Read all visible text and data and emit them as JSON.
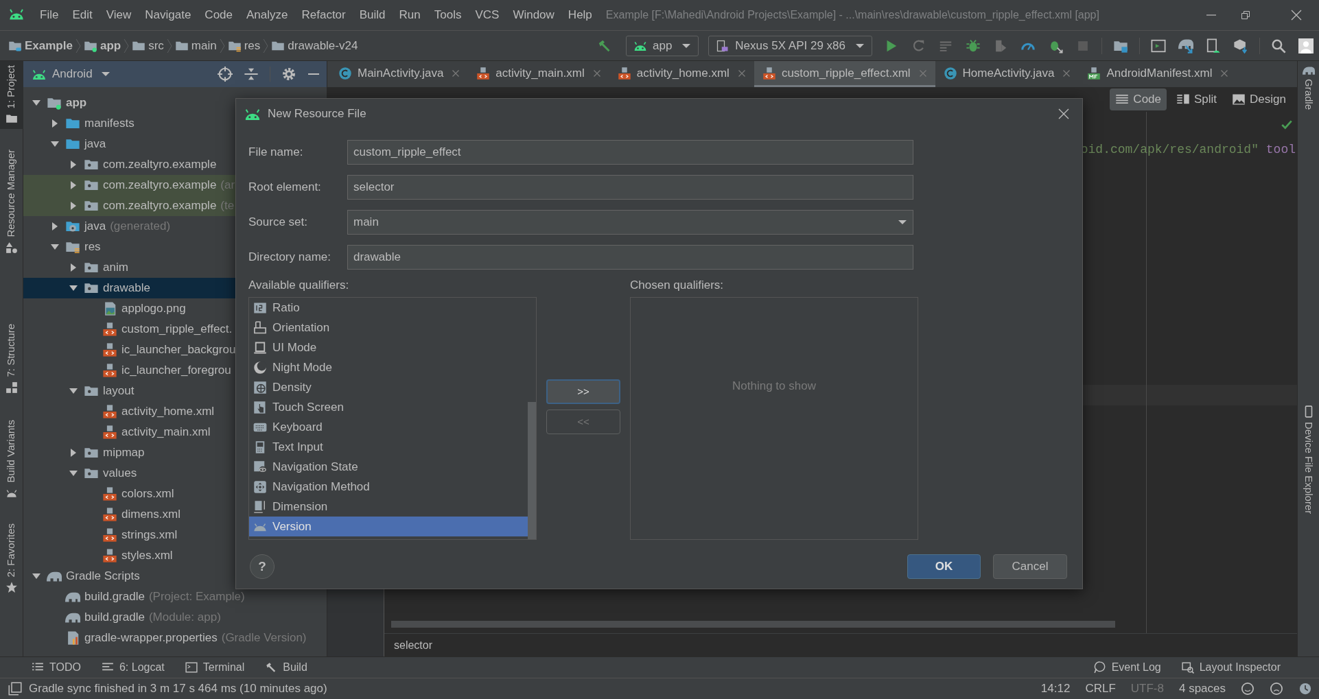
{
  "menu_bar": {
    "menus": [
      "File",
      "Edit",
      "View",
      "Navigate",
      "Code",
      "Analyze",
      "Refactor",
      "Build",
      "Run",
      "Tools",
      "VCS",
      "Window",
      "Help"
    ],
    "title": "Example [F:\\Mahedi\\Android Projects\\Example] - ...\\main\\res\\drawable\\custom_ripple_effect.xml [app]"
  },
  "breadcrumbs": [
    {
      "label": "Example",
      "kind": "project"
    },
    {
      "label": "app",
      "kind": "module"
    },
    {
      "label": "src",
      "kind": "folder"
    },
    {
      "label": "main",
      "kind": "folder"
    },
    {
      "label": "res",
      "kind": "res"
    },
    {
      "label": "drawable-v24",
      "kind": "folder"
    }
  ],
  "run_toolbar": {
    "configuration": "app",
    "device": "Nexus 5X API 29 x86"
  },
  "left_strip": [
    {
      "label": "1: Project",
      "kind": "project",
      "selected": true
    },
    {
      "label": "Resource Manager",
      "kind": "resources",
      "selected": false
    },
    {
      "label": "7: Structure",
      "kind": "structure",
      "selected": false
    },
    {
      "label": "Build Variants",
      "kind": "variants",
      "selected": false
    },
    {
      "label": "2: Favorites",
      "kind": "favorites",
      "selected": false
    }
  ],
  "project_panel": {
    "view": "Android",
    "tree": [
      {
        "label": "app",
        "kind": "module",
        "expanded": true,
        "selected": false,
        "children": [
          {
            "label": "manifests",
            "kind": "folder_blue",
            "expanded": false,
            "selected": false
          },
          {
            "label": "java",
            "kind": "folder_blue",
            "expanded": true,
            "selected": false,
            "children": [
              {
                "label": "com.zealtyro.example",
                "kind": "package",
                "expanded": false,
                "selected": false
              },
              {
                "label": "com.zealtyro.example",
                "note": "(ar",
                "kind": "package_test",
                "expanded": false,
                "selected": false
              },
              {
                "label": "com.zealtyro.example",
                "note": "(te",
                "kind": "package_test",
                "expanded": false,
                "selected": false
              }
            ]
          },
          {
            "label": "java",
            "note": "(generated)",
            "kind": "generated",
            "expanded": false,
            "selected": false
          },
          {
            "label": "res",
            "kind": "res",
            "expanded": true,
            "selected": false,
            "children": [
              {
                "label": "anim",
                "kind": "package",
                "expanded": false,
                "selected": false
              },
              {
                "label": "drawable",
                "kind": "package",
                "expanded": true,
                "selected": true,
                "children": [
                  {
                    "label": "applogo.png",
                    "kind": "image",
                    "selected": false
                  },
                  {
                    "label": "custom_ripple_effect.",
                    "kind": "xml",
                    "selected": false
                  },
                  {
                    "label": "ic_launcher_backgrou",
                    "kind": "xml",
                    "selected": false
                  },
                  {
                    "label": "ic_launcher_foregrou",
                    "kind": "xml",
                    "selected": false
                  }
                ]
              },
              {
                "label": "layout",
                "kind": "package",
                "expanded": true,
                "selected": false,
                "children": [
                  {
                    "label": "activity_home.xml",
                    "kind": "xml",
                    "selected": false
                  },
                  {
                    "label": "activity_main.xml",
                    "kind": "xml",
                    "selected": false
                  }
                ]
              },
              {
                "label": "mipmap",
                "kind": "package",
                "expanded": false,
                "selected": false
              },
              {
                "label": "values",
                "kind": "package",
                "expanded": true,
                "selected": false,
                "children": [
                  {
                    "label": "colors.xml",
                    "kind": "xml",
                    "selected": false
                  },
                  {
                    "label": "dimens.xml",
                    "kind": "xml",
                    "selected": false
                  },
                  {
                    "label": "strings.xml",
                    "kind": "xml",
                    "selected": false
                  },
                  {
                    "label": "styles.xml",
                    "kind": "xml",
                    "selected": false
                  }
                ]
              }
            ]
          }
        ]
      },
      {
        "label": "Gradle Scripts",
        "kind": "gradle_group",
        "expanded": true,
        "selected": false,
        "children": [
          {
            "label": "build.gradle",
            "note": "(Project: Example)",
            "kind": "gradle",
            "selected": false
          },
          {
            "label": "build.gradle",
            "note": "(Module: app)",
            "kind": "gradle",
            "selected": false
          },
          {
            "label": "gradle-wrapper.properties",
            "note": "(Gradle Version)",
            "kind": "properties",
            "selected": false
          }
        ]
      }
    ]
  },
  "editor_tabs": [
    {
      "label": "MainActivity.java",
      "kind": "java",
      "selected": false
    },
    {
      "label": "activity_main.xml",
      "kind": "xml",
      "selected": false
    },
    {
      "label": "activity_home.xml",
      "kind": "xml",
      "selected": false
    },
    {
      "label": "custom_ripple_effect.xml",
      "kind": "xml",
      "selected": true
    },
    {
      "label": "HomeActivity.java",
      "kind": "java",
      "selected": false
    },
    {
      "label": "AndroidManifest.xml",
      "kind": "manifest",
      "selected": false
    }
  ],
  "view_modes": [
    {
      "label": "Code",
      "kind": "code",
      "selected": true
    },
    {
      "label": "Split",
      "kind": "split",
      "selected": false
    },
    {
      "label": "Design",
      "kind": "design",
      "selected": false
    }
  ],
  "editor": {
    "code_line": [
      {
        "text": "oid.com/apk/res/android\"",
        "kind": "string"
      },
      {
        "text": " tool",
        "kind": "attribute"
      }
    ],
    "breadcrumb": "selector"
  },
  "right_strip": [
    {
      "label": "Gradle",
      "kind": "gradle"
    },
    {
      "label": "Device File Explorer",
      "kind": "device"
    }
  ],
  "dialog": {
    "title": "New Resource File",
    "fields": [
      {
        "label": "File name:",
        "value": "custom_ripple_effect",
        "kind": "text"
      },
      {
        "label": "Root element:",
        "value": "selector",
        "kind": "text"
      },
      {
        "label": "Source set:",
        "value": "main",
        "kind": "dropdown"
      },
      {
        "label": "Directory name:",
        "value": "drawable",
        "kind": "text"
      }
    ],
    "available_label": "Available qualifiers:",
    "chosen_label": "Chosen qualifiers:",
    "qualifiers": [
      {
        "label": "Ratio",
        "kind": "ratio",
        "selected": false
      },
      {
        "label": "Orientation",
        "kind": "orientation",
        "selected": false
      },
      {
        "label": "UI Mode",
        "kind": "uimode",
        "selected": false
      },
      {
        "label": "Night Mode",
        "kind": "night",
        "selected": false
      },
      {
        "label": "Density",
        "kind": "density",
        "selected": false
      },
      {
        "label": "Touch Screen",
        "kind": "touch",
        "selected": false
      },
      {
        "label": "Keyboard",
        "kind": "keyboard",
        "selected": false
      },
      {
        "label": "Text Input",
        "kind": "textinput",
        "selected": false
      },
      {
        "label": "Navigation State",
        "kind": "navstate",
        "selected": false
      },
      {
        "label": "Navigation Method",
        "kind": "navmethod",
        "selected": false
      },
      {
        "label": "Dimension",
        "kind": "dimension",
        "selected": false
      },
      {
        "label": "Version",
        "kind": "version",
        "selected": true
      }
    ],
    "add_button": ">>",
    "remove_button": "<<",
    "chosen_empty": "Nothing to show",
    "help": "?",
    "ok": "OK",
    "cancel": "Cancel"
  },
  "bottom_tools": [
    {
      "label": "TODO",
      "kind": "todo"
    },
    {
      "label": "6: Logcat",
      "kind": "logcat"
    },
    {
      "label": "Terminal",
      "kind": "terminal"
    },
    {
      "label": "Build",
      "kind": "build"
    }
  ],
  "bottom_tools_right": [
    {
      "label": "Event Log",
      "kind": "eventlog"
    },
    {
      "label": "Layout Inspector",
      "kind": "inspector"
    }
  ],
  "status_bar": {
    "message": "Gradle sync finished in 3 m 17 s 464 ms (10 minutes ago)",
    "position": "14:12",
    "line_ending": "CRLF",
    "encoding": "UTF-8",
    "indent": "4 spaces"
  }
}
